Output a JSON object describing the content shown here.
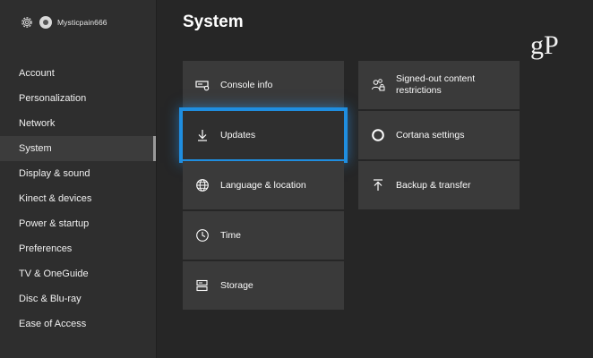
{
  "profile": {
    "gamertag": "Mysticpain666"
  },
  "sidebar": {
    "items": [
      {
        "label": "Account"
      },
      {
        "label": "Personalization"
      },
      {
        "label": "Network"
      },
      {
        "label": "System",
        "active": true
      },
      {
        "label": "Display & sound"
      },
      {
        "label": "Kinect & devices"
      },
      {
        "label": "Power & startup"
      },
      {
        "label": "Preferences"
      },
      {
        "label": "TV & OneGuide"
      },
      {
        "label": "Disc & Blu-ray"
      },
      {
        "label": "Ease of Access"
      }
    ]
  },
  "main": {
    "title": "System",
    "watermark": "gP",
    "left_column": [
      {
        "label": "Console info",
        "icon": "console-info-icon"
      },
      {
        "label": "Updates",
        "icon": "download-arrow-icon",
        "focused": true
      },
      {
        "label": "Language & location",
        "icon": "globe-icon"
      },
      {
        "label": "Time",
        "icon": "clock-icon"
      },
      {
        "label": "Storage",
        "icon": "storage-icon"
      }
    ],
    "right_column": [
      {
        "label": "Signed-out content restrictions",
        "icon": "people-lock-icon"
      },
      {
        "label": "Cortana settings",
        "icon": "cortana-circle-icon"
      },
      {
        "label": "Backup & transfer",
        "icon": "upload-arrow-icon"
      }
    ]
  },
  "colors": {
    "accent": "#1f8ee0",
    "background": "#262626",
    "sidebar": "#2e2e2e",
    "tile": "#3a3a3a"
  }
}
